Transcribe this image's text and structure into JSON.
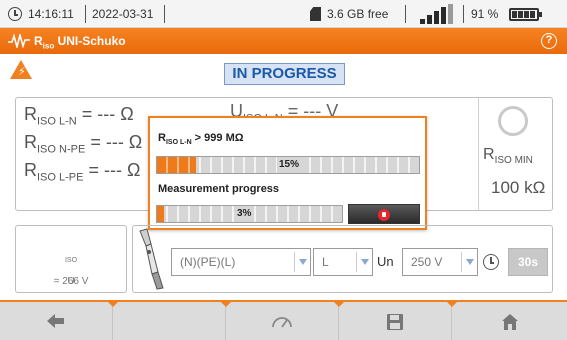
{
  "status_bar": {
    "time": "14:16:11",
    "date": "2022-03-31",
    "storage": "3.6 GB free",
    "battery": "91 %",
    "signal_level": 4,
    "battery_level": 0.91
  },
  "header": {
    "title_main": "R",
    "title_sub": "iso",
    "title_rest": " UNI-Schuko",
    "help": "?"
  },
  "status_label": "IN PROGRESS",
  "readings": [
    {
      "main": "R",
      "sub": "ISO L-N",
      "value": "= --- Ω"
    },
    {
      "main": "R",
      "sub": "ISO N-PE",
      "value": "= --- Ω"
    },
    {
      "main": "R",
      "sub": "ISO L-PE",
      "value": "= --- Ω"
    }
  ],
  "uiso_reading": {
    "main": "U",
    "sub": "ISO L-N",
    "value": "= --- V"
  },
  "min_block": {
    "label_main": "R",
    "label_sub": "ISO MIN",
    "value": "100 kΩ"
  },
  "dialog": {
    "result_main": "R",
    "result_sub": "ISO L-N",
    "result_value": " > 999 MΩ",
    "bar1_percent": "15%",
    "bar1_fraction": 0.15,
    "progress_label": "Measurement progress",
    "bar2_percent": "3%",
    "bar2_fraction": 0.03
  },
  "uiso_box": {
    "main": "U",
    "sub": "ISO",
    "value": " = 266 V"
  },
  "settings": {
    "combo_pe": "(N)(PE)(L)",
    "combo_l": "L",
    "un_label": "Un",
    "combo_un": "250 V",
    "time_value": "30s"
  },
  "colors": {
    "accent": "#f08020",
    "progress_fill": "#ee7a1a",
    "status_text": "#1b5aa8"
  }
}
